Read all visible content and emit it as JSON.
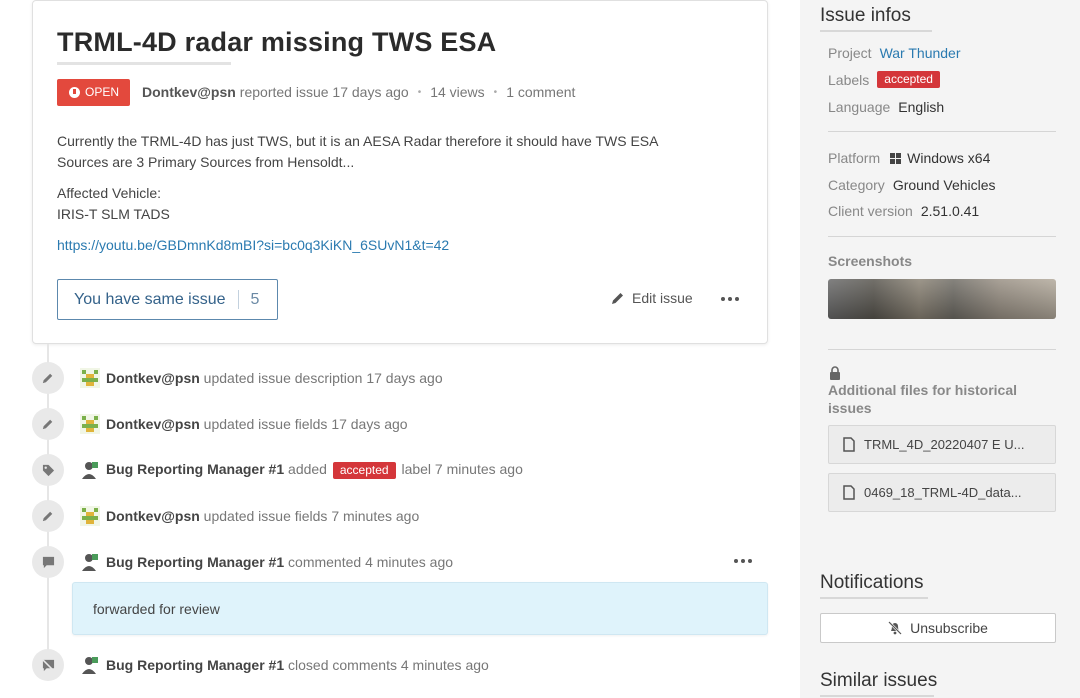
{
  "issue": {
    "title": "TRML-4D radar missing TWS ESA",
    "status": "OPEN",
    "author": "Dontkev@psn",
    "reported": "reported issue 17 days ago",
    "views": "14 views",
    "comments": "1 comment",
    "description_line1": "Currently the TRML-4D has just TWS, but it is an AESA Radar therefore it should have TWS ESA",
    "description_line2": "Sources are 3 Primary Sources from Hensoldt...",
    "affected_label": "Affected Vehicle:",
    "affected_value": "IRIS-T SLM TADS",
    "link": "https://youtu.be/GBDmnKd8mBI?si=bc0q3KiKN_6SUvN1&t=42",
    "same_issue_label": "You have same issue",
    "same_issue_count": "5",
    "edit_label": "Edit issue"
  },
  "timeline": [
    {
      "who": "Dontkev@psn",
      "text": "updated issue description 17 days ago",
      "icon": "pencil-icon"
    },
    {
      "who": "Dontkev@psn",
      "text": "updated issue fields 17 days ago",
      "icon": "pencil-icon"
    },
    {
      "who": "Bug Reporting Manager #1",
      "text_before": "added",
      "label": "accepted",
      "text_after": "label 7 minutes ago",
      "icon": "tag-icon"
    },
    {
      "who": "Dontkev@psn",
      "text": "updated issue fields 7 minutes ago",
      "icon": "pencil-icon"
    },
    {
      "who": "Bug Reporting Manager #1",
      "text": "commented 4 minutes ago",
      "icon": "comment-icon"
    },
    {
      "who": "Bug Reporting Manager #1",
      "text": "closed comments 4 minutes ago",
      "icon": "comment-closed-icon"
    }
  ],
  "comment": {
    "text": "forwarded for review"
  },
  "sidebar": {
    "infos_title": "Issue infos",
    "project_label": "Project",
    "project_value": "War Thunder",
    "labels_label": "Labels",
    "labels_value": "accepted",
    "language_label": "Language",
    "language_value": "English",
    "platform_label": "Platform",
    "platform_value": "Windows x64",
    "category_label": "Category",
    "category_value": "Ground Vehicles",
    "client_label": "Client version",
    "client_value": "2.51.0.41",
    "screenshots_label": "Screenshots",
    "additional_files_label": "Additional files for historical issues",
    "files": [
      "TRML_4D_20220407 E U...",
      "0469_18_TRML-4D_data..."
    ],
    "notifications_title": "Notifications",
    "unsubscribe_label": "Unsubscribe",
    "similar_title": "Similar issues"
  },
  "colors": {
    "open_badge": "#e3493d",
    "accepted_label": "#d4363a",
    "link": "#2a7ab0",
    "comment_bg": "#dff3fb"
  }
}
